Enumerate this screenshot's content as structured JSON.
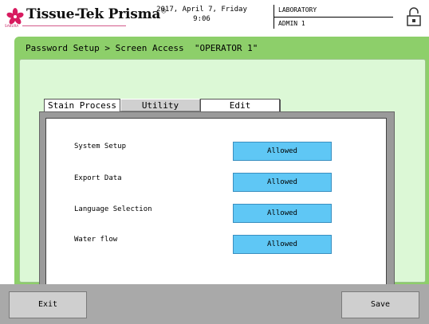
{
  "header": {
    "brand": "Tissue-Tek Prisma",
    "brand_mark": "®",
    "maker": "SAKURA",
    "date": "2017, April 7, Friday",
    "time": "9:06",
    "site": "LABORATORY",
    "user": "ADMIN 1",
    "logo_color": "#d81b60",
    "lock_icon": "lock-icon"
  },
  "panel": {
    "title": "Password Setup > Screen Access  \"OPERATOR 1\""
  },
  "tabs": [
    {
      "label": "Stain Process",
      "selected": false
    },
    {
      "label": "Utility",
      "selected": true
    },
    {
      "label": "Edit",
      "selected": false
    }
  ],
  "rows": [
    {
      "label": "System Setup",
      "value": "Allowed"
    },
    {
      "label": "Export Data",
      "value": "Allowed"
    },
    {
      "label": "Language Selection",
      "value": "Allowed"
    },
    {
      "label": "Water flow",
      "value": "Allowed"
    }
  ],
  "footer": {
    "exit_label": "Exit",
    "save_label": "Save"
  },
  "colors": {
    "panel_green": "#8dcf6a",
    "panel_light": "#dcf8d6",
    "allowed_blue": "#5fc7f5",
    "footer_gray": "#a9a9a9"
  }
}
